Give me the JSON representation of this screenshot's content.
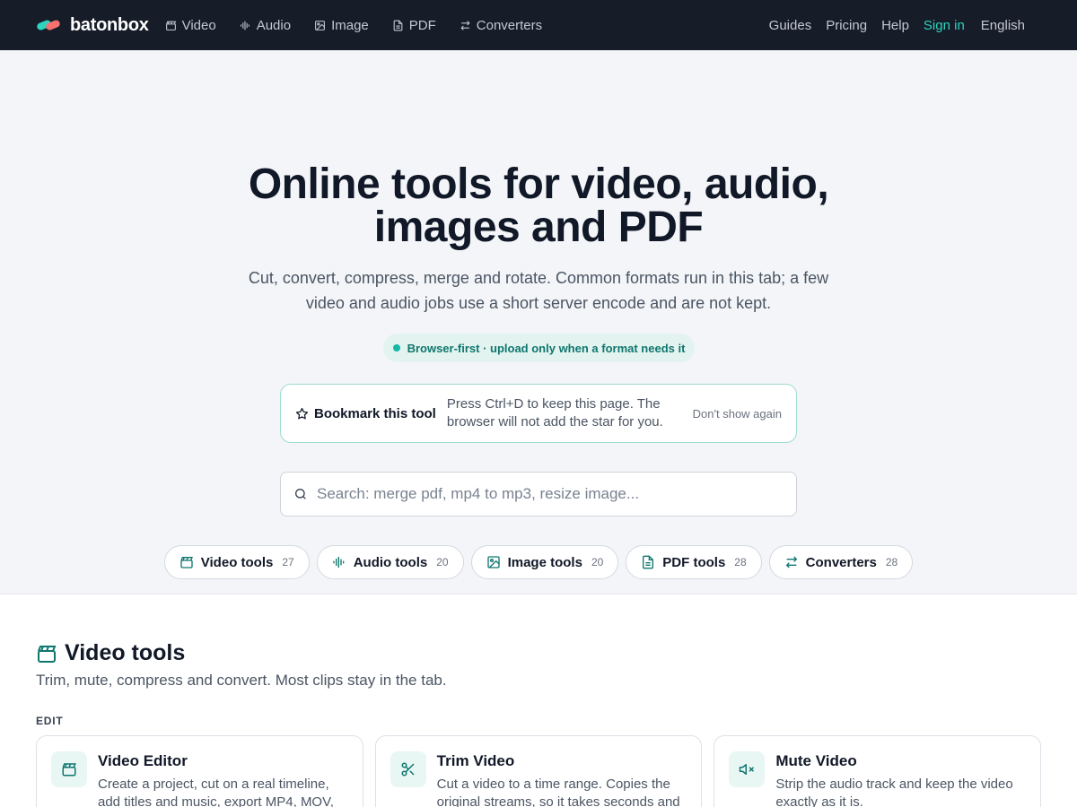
{
  "colors": {
    "accent": "#2dd4bf",
    "nav_bg": "#161c28",
    "hero_bg": "#f3f5f8",
    "icon_teal": "#0f766e"
  },
  "nav": {
    "brand": "batonbox",
    "links": [
      {
        "label": "Video",
        "icon": "clapperboard-icon"
      },
      {
        "label": "Audio",
        "icon": "waveform-icon"
      },
      {
        "label": "Image",
        "icon": "image-icon"
      },
      {
        "label": "PDF",
        "icon": "file-icon"
      },
      {
        "label": "Converters",
        "icon": "swap-icon"
      }
    ],
    "right": {
      "guides": "Guides",
      "pricing": "Pricing",
      "help": "Help",
      "signin": "Sign in",
      "language": "English"
    }
  },
  "hero": {
    "title_line1": "Online tools for video, audio,",
    "title_line2": "images and PDF",
    "subtitle_line1": "Cut, convert, compress, merge and rotate. Common formats run in this tab; a few",
    "subtitle_line2": "video and audio jobs use a short server encode and are not kept.",
    "pill": "Browser-first · upload only when a format needs it",
    "bookmark": {
      "title": "Bookmark this tool",
      "text": "Press Ctrl+D to keep this page. The browser will not add the star for you.",
      "dismiss": "Don't show again"
    },
    "search": {
      "placeholder": "Search: merge pdf, mp4 to mp3, resize image...",
      "value": ""
    },
    "chips": [
      {
        "label": "Video tools",
        "count": "27",
        "icon": "clapperboard-icon"
      },
      {
        "label": "Audio tools",
        "count": "20",
        "icon": "waveform-icon"
      },
      {
        "label": "Image tools",
        "count": "20",
        "icon": "image-icon"
      },
      {
        "label": "PDF tools",
        "count": "28",
        "icon": "file-icon"
      },
      {
        "label": "Converters",
        "count": "28",
        "icon": "swap-icon"
      }
    ]
  },
  "video_section": {
    "title": "Video tools",
    "description": "Trim, mute, compress and convert. Most clips stay in the tab.",
    "group": "EDIT",
    "cards": [
      {
        "title": "Video Editor",
        "desc": "Create a project, cut on a real timeline, add titles and music, export MP4, MOV,",
        "icon": "clapperboard-icon"
      },
      {
        "title": "Trim Video",
        "desc": "Cut a video to a time range. Copies the original streams, so it takes seconds and",
        "icon": "scissors-icon"
      },
      {
        "title": "Mute Video",
        "desc": "Strip the audio track and keep the video exactly as it is.",
        "icon": "speaker-mute-icon"
      }
    ]
  }
}
